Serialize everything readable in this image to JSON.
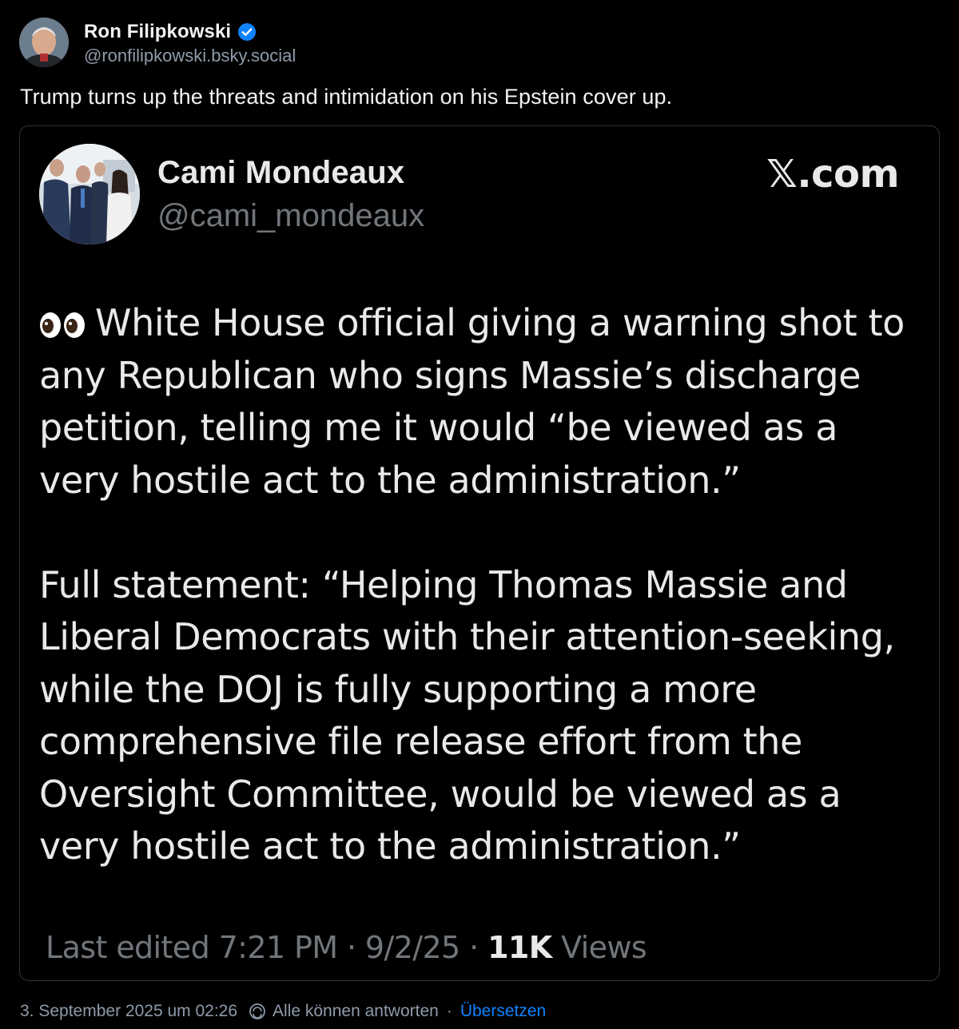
{
  "post": {
    "author": {
      "name": "Ron Filipkowski",
      "handle": "@ronfilipkowski.bsky.social",
      "verified": true,
      "verified_color": "#1083fe"
    },
    "text": "Trump turns up the threats and intimidation on his Epstein cover up."
  },
  "embed": {
    "author": {
      "name": "Cami Mondeaux",
      "handle": "@cami_mondeaux"
    },
    "brand": "𝕏.com",
    "paragraphs": [
      "White House official giving a warning shot to any Republican who signs Massie’s discharge petition, telling me it would “be viewed as a very hostile act to the administration.”",
      "Full statement: “Helping Thomas Massie and Liberal Democrats with their attention-seeking, while the DOJ is fully supporting a more comprehensive file release effort from the Oversight Committee, would be viewed as a very hostile act to the administration.”"
    ],
    "meta": {
      "edited": "Last edited 7:21 PM · 9/2/25 · ",
      "views_count": "11K",
      "views_label": " Views"
    }
  },
  "footer": {
    "timestamp": "3. September 2025 um 02:26",
    "reply_setting": "Alle können antworten",
    "separator": "·",
    "translate": "Übersetzen"
  },
  "colors": {
    "background": "#000000",
    "text": "#f1f3f5",
    "muted": "#8e9baa",
    "link": "#1083fe",
    "card_border": "#2b3440"
  }
}
